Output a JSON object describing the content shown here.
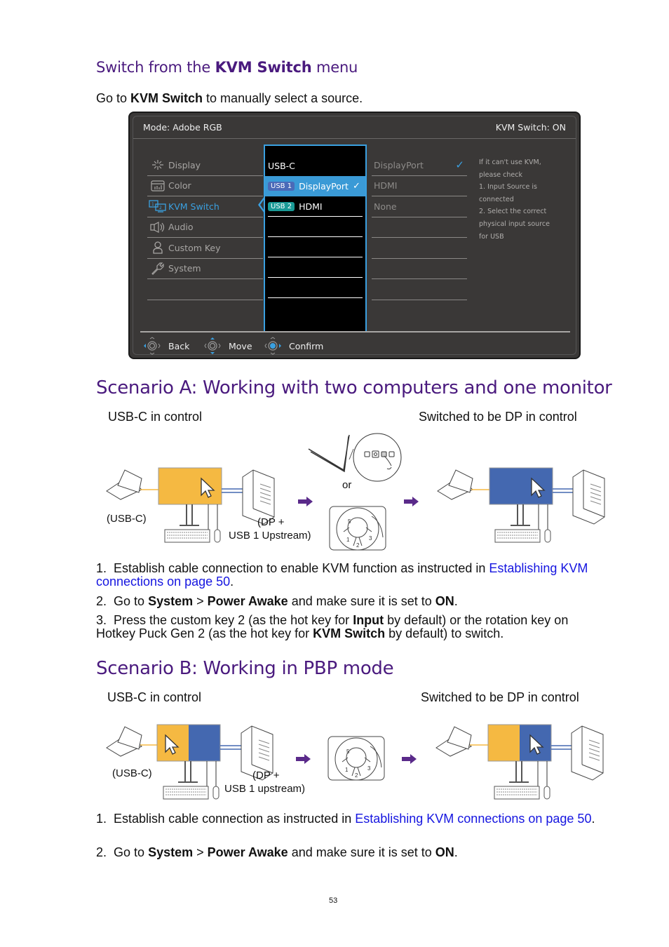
{
  "section_kvm": {
    "title_pre": "Switch from the ",
    "title_bold": "KVM Switch",
    "title_post": " menu",
    "intro_pre": "Go to ",
    "intro_bold": "KVM Switch",
    "intro_post": " to manually select a source."
  },
  "osd": {
    "mode": "Mode: Adobe RGB",
    "kvm_status": "KVM Switch: ON",
    "menu": [
      {
        "label": "Display",
        "icon": "display-icon",
        "glyph": "⁜"
      },
      {
        "label": "Color",
        "icon": "color-icon",
        "glyph": "▥"
      },
      {
        "label": "KVM Switch",
        "icon": "kvm-icon",
        "glyph": "⧉"
      },
      {
        "label": "Audio",
        "icon": "audio-icon",
        "glyph": "🔈"
      },
      {
        "label": "Custom Key",
        "icon": "custom-key-icon",
        "glyph": "👤"
      },
      {
        "label": "System",
        "icon": "system-icon",
        "glyph": "🔧"
      }
    ],
    "submenu": [
      {
        "label": "USB-C"
      },
      {
        "badge": "USB 1",
        "label": "DisplayPort",
        "check": "✓"
      },
      {
        "badge": "USB 2",
        "label": "HDMI"
      }
    ],
    "options": [
      {
        "label": "DisplayPort",
        "check": "✓"
      },
      {
        "label": "HDMI"
      },
      {
        "label": "None"
      }
    ],
    "help": [
      "If it can't use KVM,",
      "please check",
      "1. Input Source is",
      "connected",
      "2. Select the correct",
      "physical input source",
      "for USB"
    ],
    "controls": {
      "back": "Back",
      "move": "Move",
      "confirm": "Confirm"
    },
    "colors": {
      "accent": "#3aa0e0",
      "badge_usb1": "#4a6ab8",
      "badge_usb2": "#1a9a96",
      "background": "#3a3837"
    }
  },
  "scenario_a": {
    "title": "Scenario A: Working with two computers and one monitor",
    "left_caption": "USB-C in control",
    "right_caption": "Switched to be DP in control",
    "label_usbc": "(USB-C)",
    "label_dp_1": "(DP +",
    "label_dp_2": "USB 1 Upstream)",
    "or": "or",
    "steps": [
      {
        "num": "1.",
        "pre": "Establish cable connection to enable KVM function as instructed in ",
        "link": "Establishing KVM connections on page 50",
        "post": "."
      },
      {
        "num": "2.",
        "pre": "Go to ",
        "b1": "System",
        "mid1": " > ",
        "b2": "Power Awake",
        "mid2": " and make sure it is set to ",
        "b3": "ON",
        "post": "."
      },
      {
        "num": "3.",
        "pre": "Press the custom key 2 (as the hot key for ",
        "b1": "Input",
        "mid1": " by default) or the rotation key on Hotkey Puck Gen 2 (as the hot key for ",
        "b2": "KVM Switch",
        "post": " by default) to switch."
      }
    ]
  },
  "scenario_b": {
    "title": "Scenario B: Working in PBP mode",
    "left_caption": "USB-C in control",
    "right_caption": "Switched to be DP in control",
    "label_usbc": "(USB-C)",
    "label_dp_1": "(DP +",
    "label_dp_2": "USB 1 upstream)",
    "steps": [
      {
        "num": "1.",
        "pre": "Establish cable connection as instructed in ",
        "link": "Establishing KVM connections on page 50",
        "post": "."
      },
      {
        "num": "2.",
        "pre": "Go to ",
        "b1": "System",
        "mid1": " > ",
        "b2": "Power Awake",
        "mid2": " and make sure it is set to ",
        "b3": "ON",
        "post": "."
      }
    ]
  },
  "colors": {
    "heading": "#4a1a7e",
    "link": "#1515e0",
    "usbc_screen": "#f5b942",
    "dp_screen": "#4468b0",
    "arrow": "#5a2a8a"
  },
  "page_number": "53"
}
